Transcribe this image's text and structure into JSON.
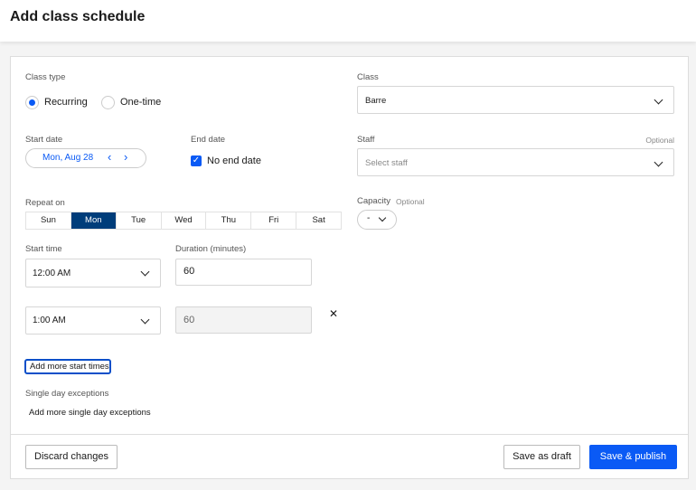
{
  "header": {
    "title": "Add class schedule"
  },
  "class_type": {
    "label": "Class type",
    "options": [
      {
        "label": "Recurring",
        "selected": true
      },
      {
        "label": "One-time",
        "selected": false
      }
    ]
  },
  "start_date": {
    "label": "Start date",
    "value": "Mon, Aug 28"
  },
  "end_date": {
    "label": "End date",
    "checkbox_label": "No end date",
    "checked": true
  },
  "repeat_on": {
    "label": "Repeat on",
    "days": [
      {
        "label": "Sun",
        "selected": false
      },
      {
        "label": "Mon",
        "selected": true
      },
      {
        "label": "Tue",
        "selected": false
      },
      {
        "label": "Wed",
        "selected": false
      },
      {
        "label": "Thu",
        "selected": false
      },
      {
        "label": "Fri",
        "selected": false
      },
      {
        "label": "Sat",
        "selected": false
      }
    ]
  },
  "start_time": {
    "label": "Start time",
    "rows": [
      {
        "time": "12:00 AM",
        "duration": "60"
      },
      {
        "time": "1:00 AM",
        "duration": "60"
      }
    ]
  },
  "duration": {
    "label": "Duration (minutes)"
  },
  "add_start_times": "Add more start times",
  "exceptions": {
    "label": "Single day exceptions",
    "add": "Add more single day exceptions"
  },
  "class": {
    "label": "Class",
    "value": "Barre"
  },
  "staff": {
    "label": "Staff",
    "optional": "Optional",
    "placeholder": "Select staff"
  },
  "capacity": {
    "label": "Capacity",
    "optional": "Optional",
    "value": "-"
  },
  "footer": {
    "discard": "Discard changes",
    "draft": "Save as draft",
    "publish": "Save & publish"
  },
  "colors": {
    "accent": "#0a5af5",
    "selected_day": "#003d7a"
  }
}
